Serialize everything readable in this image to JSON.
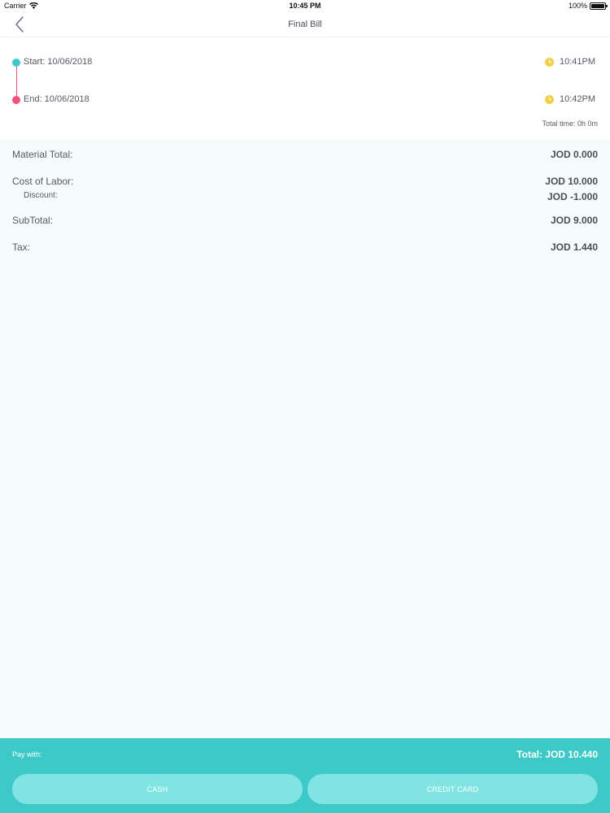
{
  "status_bar": {
    "carrier": "Carrier",
    "time": "10:45 PM",
    "battery": "100%",
    "icons": [
      "wifi-icon",
      "battery-icon"
    ]
  },
  "nav": {
    "title": "Final Bill",
    "back_icon": "chevron-left-icon"
  },
  "timeline": {
    "start_label": "Start: 10/06/2018",
    "start_time": "10:41PM",
    "end_label": "End: 10/06/2018",
    "end_time": "10:42PM",
    "total_time": "Total time: 0h 0m",
    "colors": {
      "start": "#3ec9c9",
      "end": "#f0527a",
      "clock": "#f3cf48"
    }
  },
  "bill": {
    "material_label": "Material Total:",
    "material_value": "JOD 0.000",
    "labor_label": "Cost of Labor:",
    "labor_value": "JOD 10.000",
    "discount_label": "Discount:",
    "discount_value": "JOD -1.000",
    "subtotal_label": "SubTotal:",
    "subtotal_value": "JOD 9.000",
    "tax_label": "Tax:",
    "tax_value": "JOD 1.440"
  },
  "footer": {
    "pay_with": "Pay with:",
    "total": "Total: JOD 10.440",
    "cash_label": "CASH",
    "card_label": "CREDIT CARD",
    "colors": {
      "bar": "#3ec9c9",
      "button": "#7fe4e2"
    }
  }
}
